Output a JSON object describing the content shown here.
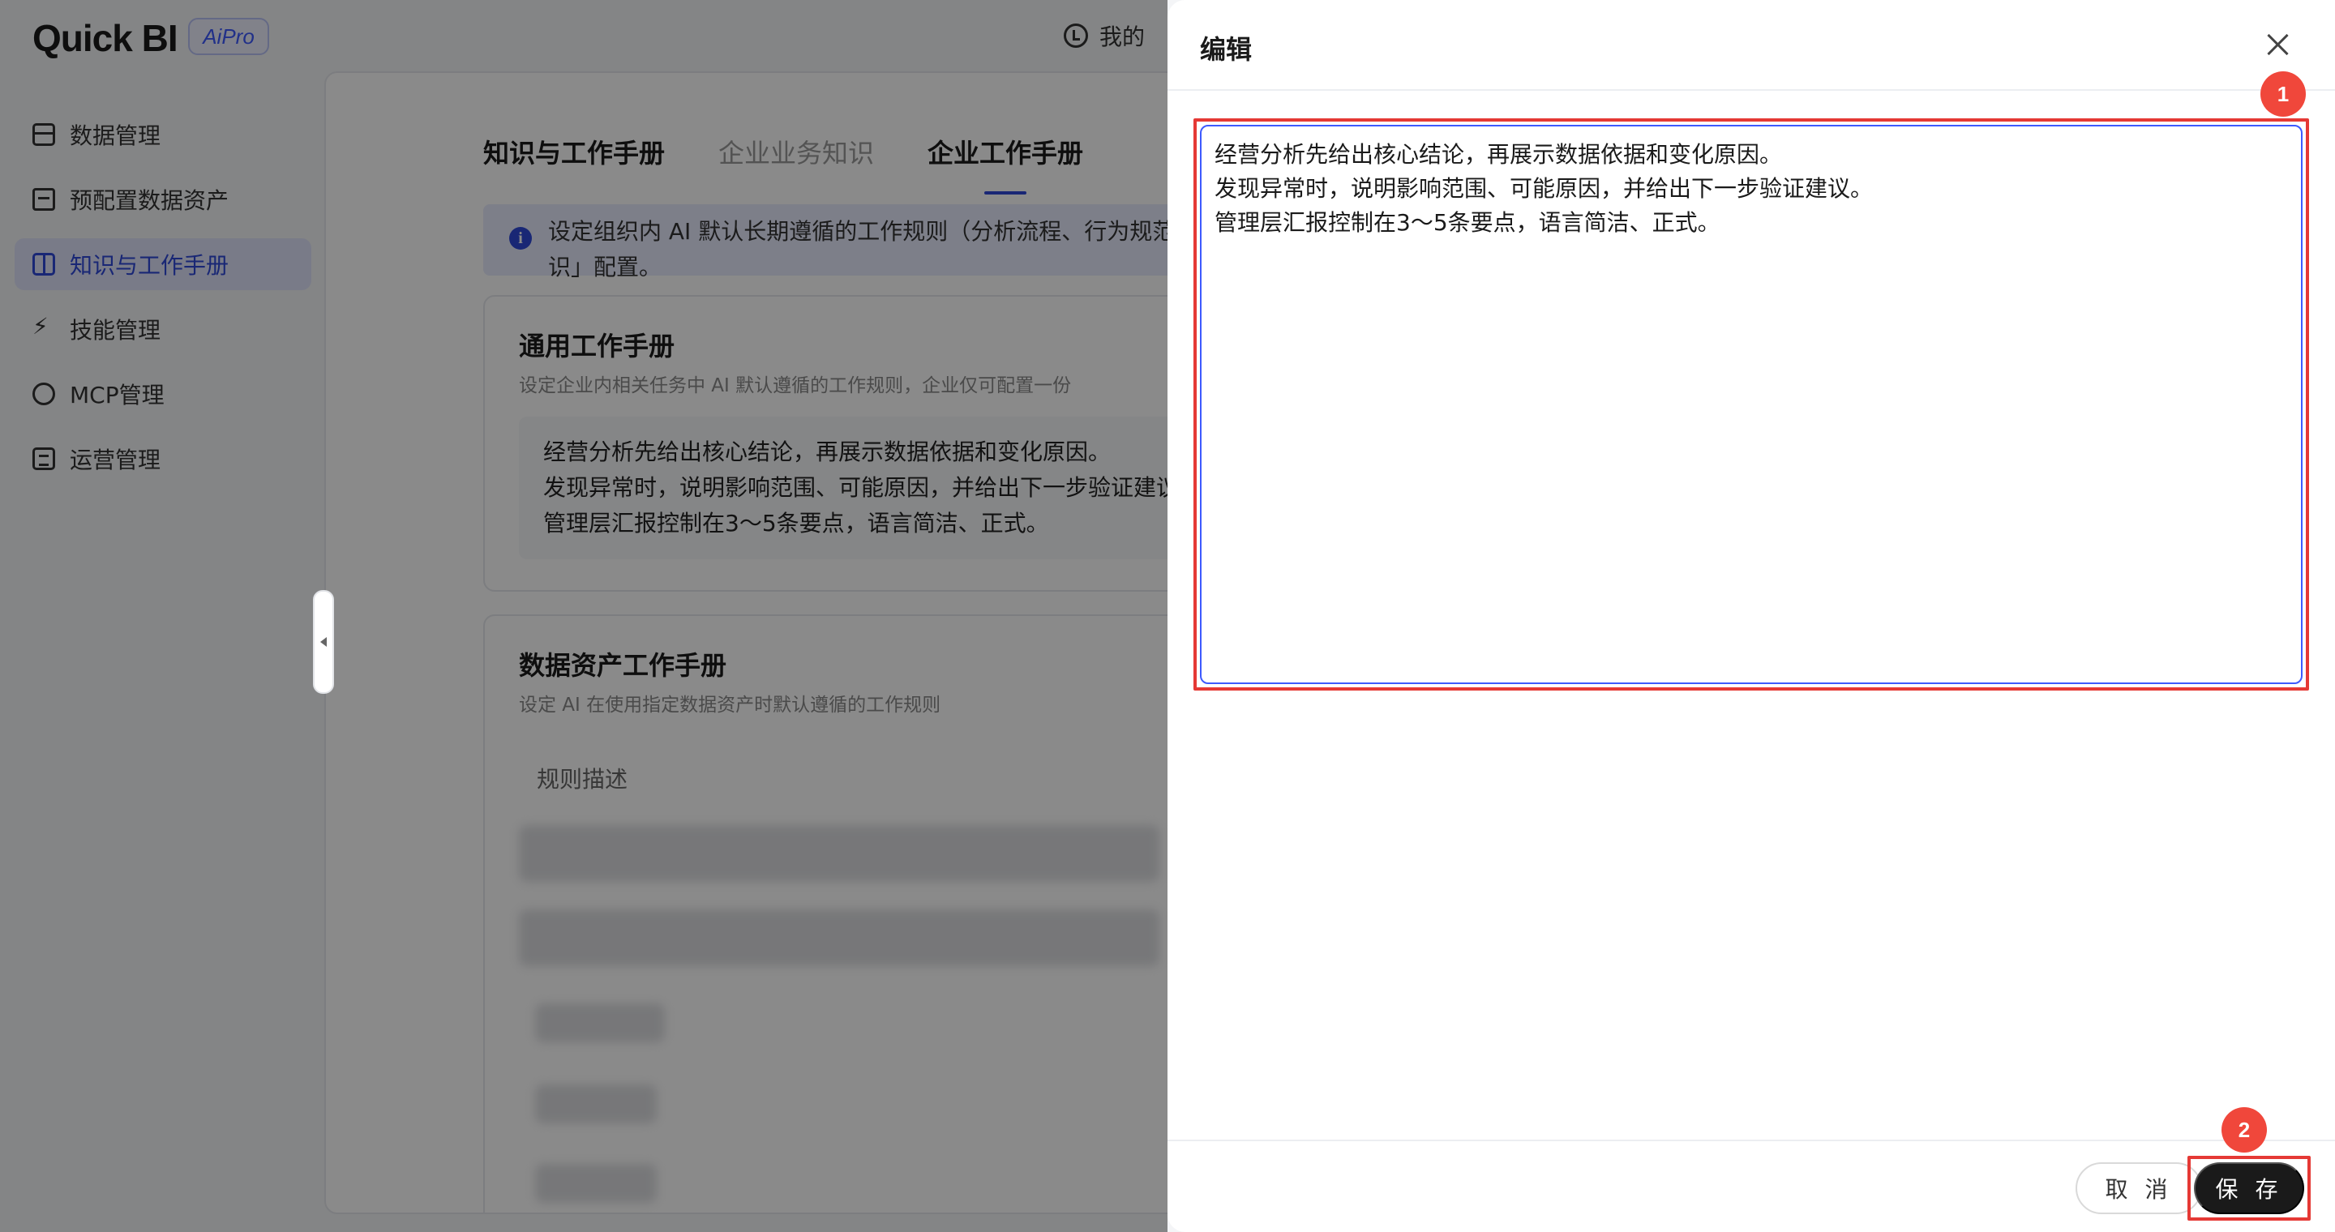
{
  "app": {
    "logo": "Quick BI",
    "badge": "AiPro",
    "user_label": "我的"
  },
  "sidebar": {
    "items": [
      {
        "label": "数据管理"
      },
      {
        "label": "预配置数据资产"
      },
      {
        "label": "知识与工作手册"
      },
      {
        "label": "技能管理"
      },
      {
        "label": "MCP管理"
      },
      {
        "label": "运营管理"
      }
    ],
    "active_index": 2
  },
  "content": {
    "page_title": "知识与工作手册",
    "tabs": [
      {
        "label": "企业业务知识"
      },
      {
        "label": "企业工作手册"
      }
    ],
    "info_text": "设定组织内 AI 默认长期遵循的工作规则（分析流程、行为规范",
    "info_text_2": "识」配置。",
    "general_card": {
      "title": "通用工作手册",
      "desc": "设定企业内相关任务中 AI 默认遵循的工作规则，企业仅可配置一份",
      "text": "经营分析先给出核心结论，再展示数据依据和变化原因。\n发现异常时，说明影响范围、可能原因，并给出下一步验证建议\n管理层汇报控制在3～5条要点，语言简洁、正式。"
    },
    "asset_card": {
      "title": "数据资产工作手册",
      "desc": "设定 AI 在使用指定数据资产时默认遵循的工作规则",
      "rule_label": "规则描述"
    }
  },
  "drawer": {
    "title": "编辑",
    "editor_text": "经营分析先给出核心结论，再展示数据依据和变化原因。\n发现异常时，说明影响范围、可能原因，并给出下一步验证建议。\n管理层汇报控制在3～5条要点，语言简洁、正式。",
    "markers": [
      "1",
      "2"
    ],
    "cancel_label": "取 消",
    "save_label": "保 存"
  },
  "colors": {
    "accent": "#2f48d8",
    "highlight": "#e53935",
    "marker": "#f0473b",
    "primary_button": "#1a1a1a"
  }
}
